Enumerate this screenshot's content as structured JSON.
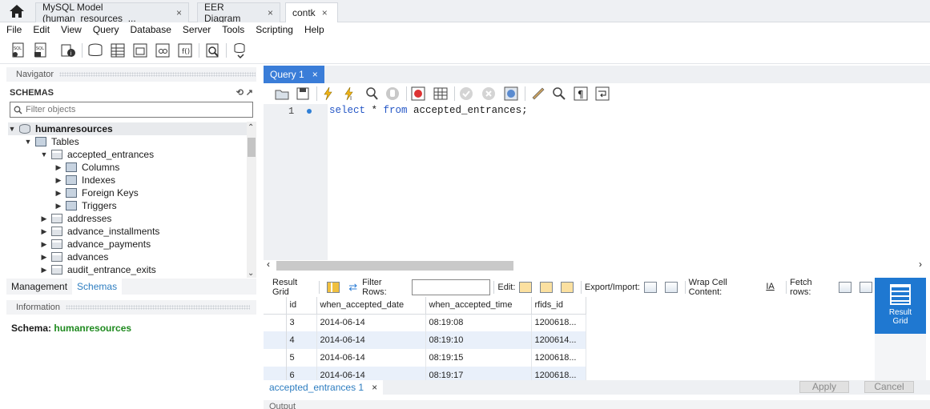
{
  "doc_tabs": [
    {
      "label": "MySQL Model (human_resources_...",
      "close": "×"
    },
    {
      "label": "EER Diagram",
      "close": "×"
    },
    {
      "label": "contk",
      "close": "×"
    }
  ],
  "menu": [
    "File",
    "Edit",
    "View",
    "Query",
    "Database",
    "Server",
    "Tools",
    "Scripting",
    "Help"
  ],
  "navigator": {
    "title": "Navigator",
    "schemas_label": "SCHEMAS",
    "filter_placeholder": "Filter objects",
    "tree": [
      {
        "label": "humanresources",
        "kind": "db"
      },
      {
        "label": "Tables",
        "kind": "folder"
      },
      {
        "label": "accepted_entrances",
        "kind": "table"
      },
      {
        "label": "Columns",
        "kind": "folder"
      },
      {
        "label": "Indexes",
        "kind": "folder"
      },
      {
        "label": "Foreign Keys",
        "kind": "folder"
      },
      {
        "label": "Triggers",
        "kind": "folder"
      },
      {
        "label": "addresses",
        "kind": "table"
      },
      {
        "label": "advance_installments",
        "kind": "table"
      },
      {
        "label": "advance_payments",
        "kind": "table"
      },
      {
        "label": "advances",
        "kind": "table"
      },
      {
        "label": "audit_entrance_exits",
        "kind": "table"
      }
    ],
    "bottom_tabs": [
      "Management",
      "Schemas"
    ]
  },
  "information": {
    "title": "Information",
    "schema_label": "Schema:",
    "schema_value": "humanresources"
  },
  "query": {
    "tab_label": "Query 1",
    "tab_close": "×",
    "line_number": "1",
    "sql_keyword1": "select",
    "sql_mid": " * ",
    "sql_keyword2": "from",
    "sql_rest": " accepted_entrances;"
  },
  "result_toolbar": {
    "result_grid": "Result Grid",
    "filter_rows": "Filter Rows:",
    "edit": "Edit:",
    "export_import": "Export/Import:",
    "wrap_cell": "Wrap Cell Content:",
    "fetch_rows": "Fetch rows:"
  },
  "grid": {
    "columns": [
      "id",
      "when_accepted_date",
      "when_accepted_time",
      "rfids_id"
    ],
    "rows": [
      [
        "3",
        "2014-06-14",
        "08:19:08",
        "1200618..."
      ],
      [
        "4",
        "2014-06-14",
        "08:19:10",
        "1200614..."
      ],
      [
        "5",
        "2014-06-14",
        "08:19:15",
        "1200618..."
      ],
      [
        "6",
        "2014-06-14",
        "08:19:17",
        "1200618..."
      ]
    ]
  },
  "side_panel": {
    "line1": "Result",
    "line2": "Grid"
  },
  "result_tab": {
    "label": "accepted_entrances 1",
    "close": "×"
  },
  "buttons": {
    "apply": "Apply",
    "cancel": "Cancel"
  },
  "output": {
    "title": "Output"
  }
}
